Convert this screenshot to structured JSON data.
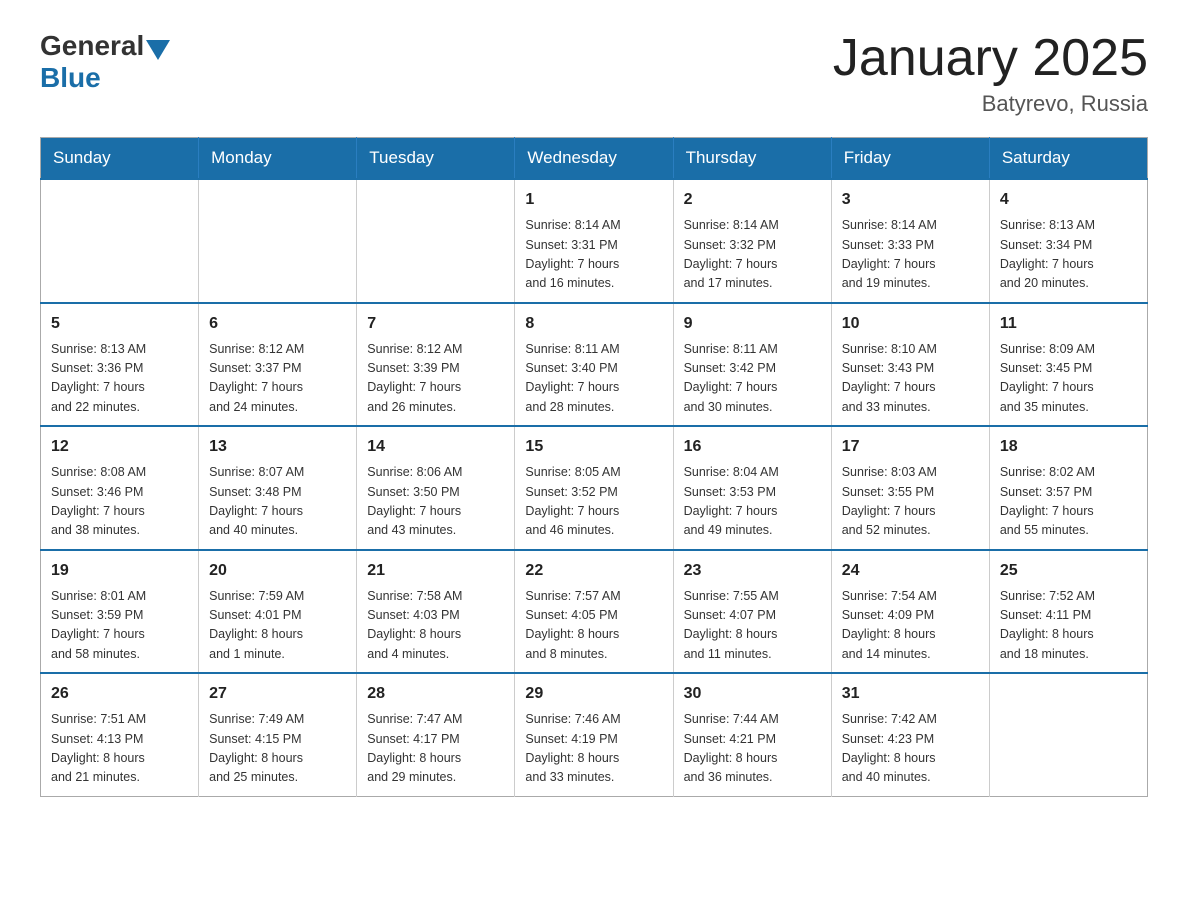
{
  "header": {
    "logo_general": "General",
    "logo_blue": "Blue",
    "title": "January 2025",
    "location": "Batyrevo, Russia"
  },
  "days_of_week": [
    "Sunday",
    "Monday",
    "Tuesday",
    "Wednesday",
    "Thursday",
    "Friday",
    "Saturday"
  ],
  "weeks": [
    [
      {
        "day": "",
        "info": ""
      },
      {
        "day": "",
        "info": ""
      },
      {
        "day": "",
        "info": ""
      },
      {
        "day": "1",
        "info": "Sunrise: 8:14 AM\nSunset: 3:31 PM\nDaylight: 7 hours\nand 16 minutes."
      },
      {
        "day": "2",
        "info": "Sunrise: 8:14 AM\nSunset: 3:32 PM\nDaylight: 7 hours\nand 17 minutes."
      },
      {
        "day": "3",
        "info": "Sunrise: 8:14 AM\nSunset: 3:33 PM\nDaylight: 7 hours\nand 19 minutes."
      },
      {
        "day": "4",
        "info": "Sunrise: 8:13 AM\nSunset: 3:34 PM\nDaylight: 7 hours\nand 20 minutes."
      }
    ],
    [
      {
        "day": "5",
        "info": "Sunrise: 8:13 AM\nSunset: 3:36 PM\nDaylight: 7 hours\nand 22 minutes."
      },
      {
        "day": "6",
        "info": "Sunrise: 8:12 AM\nSunset: 3:37 PM\nDaylight: 7 hours\nand 24 minutes."
      },
      {
        "day": "7",
        "info": "Sunrise: 8:12 AM\nSunset: 3:39 PM\nDaylight: 7 hours\nand 26 minutes."
      },
      {
        "day": "8",
        "info": "Sunrise: 8:11 AM\nSunset: 3:40 PM\nDaylight: 7 hours\nand 28 minutes."
      },
      {
        "day": "9",
        "info": "Sunrise: 8:11 AM\nSunset: 3:42 PM\nDaylight: 7 hours\nand 30 minutes."
      },
      {
        "day": "10",
        "info": "Sunrise: 8:10 AM\nSunset: 3:43 PM\nDaylight: 7 hours\nand 33 minutes."
      },
      {
        "day": "11",
        "info": "Sunrise: 8:09 AM\nSunset: 3:45 PM\nDaylight: 7 hours\nand 35 minutes."
      }
    ],
    [
      {
        "day": "12",
        "info": "Sunrise: 8:08 AM\nSunset: 3:46 PM\nDaylight: 7 hours\nand 38 minutes."
      },
      {
        "day": "13",
        "info": "Sunrise: 8:07 AM\nSunset: 3:48 PM\nDaylight: 7 hours\nand 40 minutes."
      },
      {
        "day": "14",
        "info": "Sunrise: 8:06 AM\nSunset: 3:50 PM\nDaylight: 7 hours\nand 43 minutes."
      },
      {
        "day": "15",
        "info": "Sunrise: 8:05 AM\nSunset: 3:52 PM\nDaylight: 7 hours\nand 46 minutes."
      },
      {
        "day": "16",
        "info": "Sunrise: 8:04 AM\nSunset: 3:53 PM\nDaylight: 7 hours\nand 49 minutes."
      },
      {
        "day": "17",
        "info": "Sunrise: 8:03 AM\nSunset: 3:55 PM\nDaylight: 7 hours\nand 52 minutes."
      },
      {
        "day": "18",
        "info": "Sunrise: 8:02 AM\nSunset: 3:57 PM\nDaylight: 7 hours\nand 55 minutes."
      }
    ],
    [
      {
        "day": "19",
        "info": "Sunrise: 8:01 AM\nSunset: 3:59 PM\nDaylight: 7 hours\nand 58 minutes."
      },
      {
        "day": "20",
        "info": "Sunrise: 7:59 AM\nSunset: 4:01 PM\nDaylight: 8 hours\nand 1 minute."
      },
      {
        "day": "21",
        "info": "Sunrise: 7:58 AM\nSunset: 4:03 PM\nDaylight: 8 hours\nand 4 minutes."
      },
      {
        "day": "22",
        "info": "Sunrise: 7:57 AM\nSunset: 4:05 PM\nDaylight: 8 hours\nand 8 minutes."
      },
      {
        "day": "23",
        "info": "Sunrise: 7:55 AM\nSunset: 4:07 PM\nDaylight: 8 hours\nand 11 minutes."
      },
      {
        "day": "24",
        "info": "Sunrise: 7:54 AM\nSunset: 4:09 PM\nDaylight: 8 hours\nand 14 minutes."
      },
      {
        "day": "25",
        "info": "Sunrise: 7:52 AM\nSunset: 4:11 PM\nDaylight: 8 hours\nand 18 minutes."
      }
    ],
    [
      {
        "day": "26",
        "info": "Sunrise: 7:51 AM\nSunset: 4:13 PM\nDaylight: 8 hours\nand 21 minutes."
      },
      {
        "day": "27",
        "info": "Sunrise: 7:49 AM\nSunset: 4:15 PM\nDaylight: 8 hours\nand 25 minutes."
      },
      {
        "day": "28",
        "info": "Sunrise: 7:47 AM\nSunset: 4:17 PM\nDaylight: 8 hours\nand 29 minutes."
      },
      {
        "day": "29",
        "info": "Sunrise: 7:46 AM\nSunset: 4:19 PM\nDaylight: 8 hours\nand 33 minutes."
      },
      {
        "day": "30",
        "info": "Sunrise: 7:44 AM\nSunset: 4:21 PM\nDaylight: 8 hours\nand 36 minutes."
      },
      {
        "day": "31",
        "info": "Sunrise: 7:42 AM\nSunset: 4:23 PM\nDaylight: 8 hours\nand 40 minutes."
      },
      {
        "day": "",
        "info": ""
      }
    ]
  ]
}
